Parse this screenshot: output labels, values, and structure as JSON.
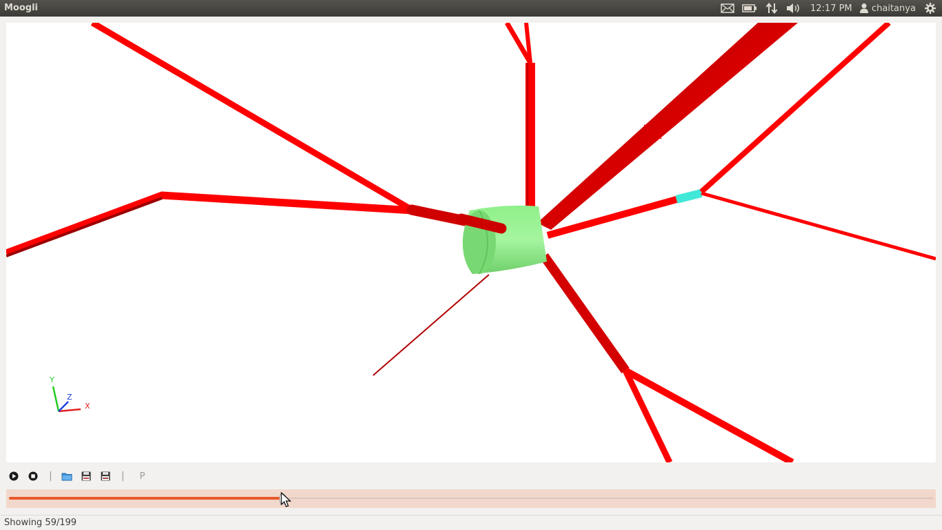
{
  "window": {
    "title": "Moogli"
  },
  "tray": {
    "mail_icon": "envelope-icon",
    "battery_icon": "battery-icon",
    "network_icon": "network-updown-icon",
    "volume_icon": "speaker-icon",
    "clock": "12:17 PM",
    "user_icon": "person-icon",
    "username": "chaitanya",
    "settings_icon": "gear-icon"
  },
  "viewport": {
    "axes": {
      "x": "X",
      "y": "Y",
      "z": "Z"
    },
    "colors": {
      "neurite": "#ff0000",
      "soma": "#8ff08a",
      "highlight": "#40e8d8",
      "background": "#ffffff"
    }
  },
  "toolbar": {
    "play_icon": "play-icon",
    "stop_icon": "stop-icon",
    "separator1": "|",
    "open_icon": "folder-open-icon",
    "save_png_icon": "save-png-icon",
    "save_avi_icon": "save-avi-icon",
    "separator2": "|",
    "p_label": "P"
  },
  "slider": {
    "current": 59,
    "total": 199,
    "progress": 0.2965,
    "accent": "#e8592a"
  },
  "status": {
    "text": "Showing 59/199"
  }
}
